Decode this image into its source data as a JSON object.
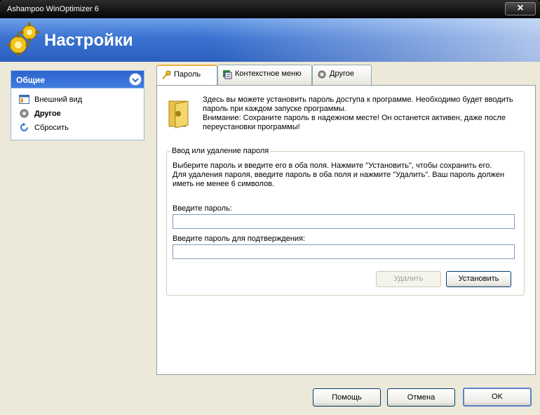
{
  "window": {
    "title": "Ashampoo WinOptimizer 6",
    "close_label": "×"
  },
  "header": {
    "title": "Настройки",
    "icon": "gears-icon"
  },
  "sidebar": {
    "title": "Общие",
    "items": [
      {
        "label": "Внешний вид",
        "icon": "appearance-icon",
        "active": false
      },
      {
        "label": "Другое",
        "icon": "gear-icon",
        "active": true
      },
      {
        "label": "Сбросить",
        "icon": "reset-icon",
        "active": false
      }
    ]
  },
  "tabs": [
    {
      "label": "Пароль",
      "icon": "key-icon",
      "active": true
    },
    {
      "label": "Контекстное меню",
      "icon": "context-menu-icon",
      "active": false
    },
    {
      "label": "Другое",
      "icon": "gear-icon",
      "active": false
    }
  ],
  "password_tab": {
    "info_lines": [
      "Здесь вы можете установить пароль доступа к программе. Необходимо будет вводить",
      "пароль при каждом запуске программы.",
      "Внимание: Сохраните пароль в  надежном месте! Он останется активен, даже после",
      "переустановки программы!"
    ],
    "group_title": "Ввод или удаление пароля",
    "group_desc_lines": [
      "Выберите пароль и введите его в оба поля. Нажмите \"Установить\", чтобы сохранить его.",
      "Для удаления пароля, введите пароль в оба поля и нажмите \"Удалить\". Ваш пароль должен",
      "иметь не менее 6 символов."
    ],
    "password_label": "Введите пароль:",
    "password_value": "",
    "confirm_label": "Введите пароль для подтверждения:",
    "confirm_value": "",
    "delete_label": "Удалить",
    "set_label": "Установить"
  },
  "footer": {
    "help_label": "Помощь",
    "cancel_label": "Отмена",
    "ok_label": "OK"
  }
}
